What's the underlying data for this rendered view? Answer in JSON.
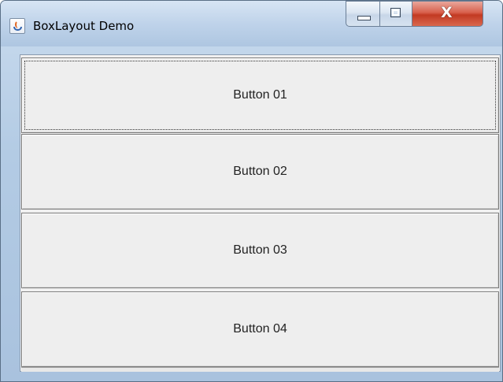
{
  "window": {
    "title": "BoxLayout Demo",
    "icon": "java-cup-icon"
  },
  "caption_buttons": {
    "minimize": "minimize-icon",
    "maximize": "maximize-icon",
    "close": "close-icon"
  },
  "buttons": [
    {
      "label": "Button 01",
      "focused": true
    },
    {
      "label": "Button 02",
      "focused": false
    },
    {
      "label": "Button 03",
      "focused": false
    },
    {
      "label": "Button 04",
      "focused": false
    }
  ],
  "colors": {
    "close_red": "#c23a23",
    "client_bg": "#f0f0f0"
  }
}
